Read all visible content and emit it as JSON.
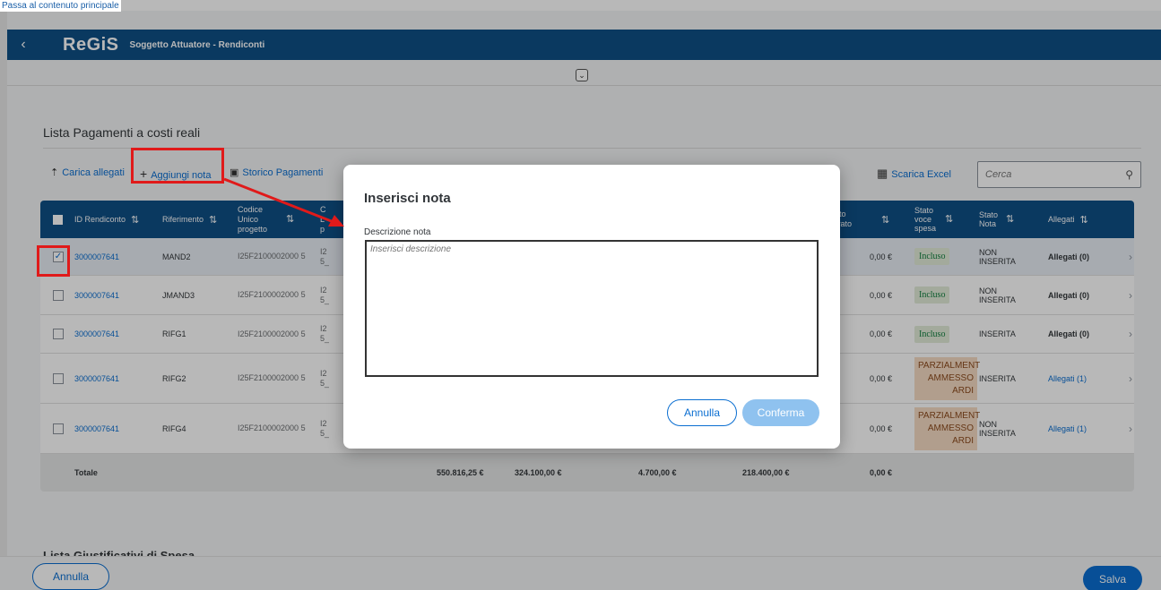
{
  "skip_link": "Passa al contenuto principale",
  "shellbar": {
    "back_icon": "‹",
    "logo": "ReGiS",
    "title": "Soggetto Attuatore - Rendiconti"
  },
  "collapse_icon": "⌄",
  "section": {
    "title": "Lista Pagamenti a costi reali"
  },
  "toolbar": {
    "carica_allegati": "Carica allegati",
    "aggiungi_nota": "Aggiungi nota",
    "storico_pagamenti": "Storico Pagamenti",
    "scarica_excel": "Scarica Excel",
    "search_placeholder": "Cerca"
  },
  "table": {
    "headers": {
      "id_rendiconto": "ID Rendiconto",
      "riferimento": "Riferimento",
      "codice_unico": "Codice Unico progetto",
      "codice_partial": "C L p",
      "importo_partial": "rto vato",
      "stato_voce": "Stato voce spesa",
      "stato_nota": "Stato Nota",
      "allegati": "Allegati"
    },
    "rows": [
      {
        "id": "3000007641",
        "rif": "MAND2",
        "cup": "I25F2100002000 5",
        "cut": "I2 5_",
        "importo": "0,00 €",
        "stato_voce": "Incluso",
        "stato_nota": "NON INSERITA",
        "allegati": "Allegati (0)"
      },
      {
        "id": "3000007641",
        "rif": "JMAND3",
        "cup": "I25F2100002000 5",
        "cut": "I2 5_",
        "importo": "0,00 €",
        "stato_voce": "Incluso",
        "stato_nota": "NON INSERITA",
        "allegati": "Allegati (0)"
      },
      {
        "id": "3000007641",
        "rif": "RIFG1",
        "cup": "I25F2100002000 5",
        "cut": "I2 5_",
        "importo": "0,00 €",
        "stato_voce": "Incluso",
        "stato_nota": "INSERITA",
        "allegati": "Allegati (0)"
      },
      {
        "id": "3000007641",
        "rif": "RIFG2",
        "cup": "I25F2100002000 5",
        "cut": "I2 5_",
        "importo": "0,00 €",
        "stato_voce": "PARZIALMENT AMMESSO ARDI",
        "stato_nota": "INSERITA",
        "allegati": "Allegati (1)"
      },
      {
        "id": "3000007641",
        "rif": "RIFG4",
        "cup": "I25F2100002000 5",
        "cut": "I2 5_",
        "importo": "0,00 €",
        "stato_voce": "PARZIALMENT AMMESSO ARDI",
        "stato_nota": "NON INSERITA",
        "allegati": "Allegati (1)"
      }
    ],
    "totals": {
      "label": "Totale",
      "v1": "550.816,25 €",
      "v2": "324.100,00 €",
      "v3": "4.700,00 €",
      "v4": "218.400,00 €",
      "v5": "0,00 €"
    }
  },
  "dialog": {
    "title": "Inserisci nota",
    "label": "Descrizione nota",
    "placeholder": "Inserisci descrizione",
    "annulla": "Annulla",
    "conferma": "Conferma"
  },
  "footer": {
    "peek": "Lista Giustificativi di Spesa",
    "annulla": "Annulla",
    "salva": "Salva"
  },
  "colors": {
    "brand": "#0f4f86",
    "accent": "#0a6ed1",
    "highlight": "#e01a1a"
  }
}
